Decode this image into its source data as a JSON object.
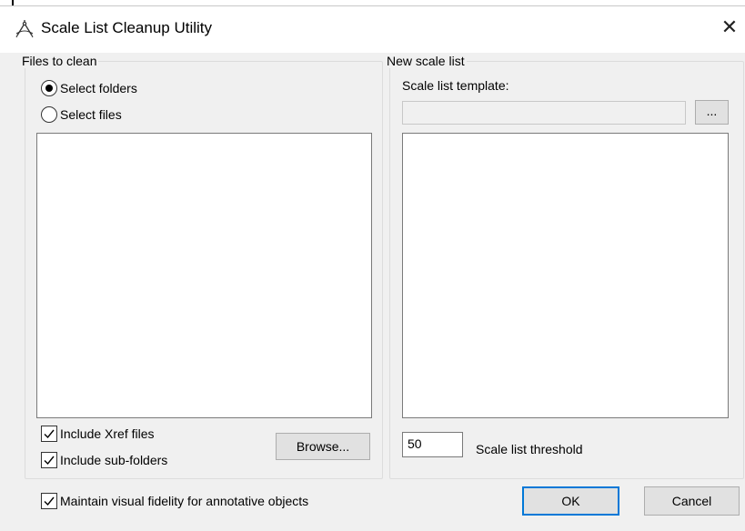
{
  "window": {
    "title": "Scale List Cleanup Utility",
    "close_glyph": "✕",
    "app_icon": "drafting-compass-icon"
  },
  "files_to_clean": {
    "legend": "Files to clean",
    "mode_options": [
      {
        "label": "Select folders",
        "selected": true
      },
      {
        "label": "Select files",
        "selected": false
      }
    ],
    "include_xref": {
      "label": "Include Xref files",
      "checked": true
    },
    "include_subfolders": {
      "label": "Include sub-folders",
      "checked": true
    },
    "browse_label": "Browse..."
  },
  "new_scale_list": {
    "legend": "New scale list",
    "template_label": "Scale list template:",
    "template_value": "",
    "ellipsis_label": "...",
    "threshold_value": "50",
    "threshold_label": "Scale list threshold"
  },
  "maintain_fidelity": {
    "label": "Maintain visual fidelity for annotative objects",
    "checked": true
  },
  "buttons": {
    "ok": "OK",
    "cancel": "Cancel"
  },
  "colors": {
    "accent": "#0078d7",
    "dialog_bg": "#f0f0f0"
  }
}
